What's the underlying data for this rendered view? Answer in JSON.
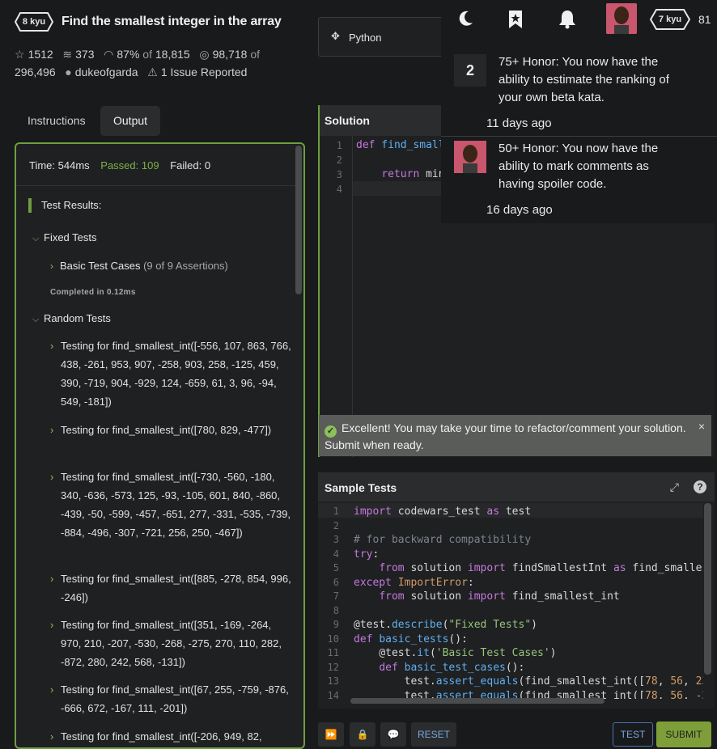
{
  "kata": {
    "rank": "8 kyu",
    "title": "Find the smallest integer in the array",
    "stars": "1512",
    "collections": "373",
    "satisfaction": "87%",
    "of_votes_prefix": "of",
    "votes": "18,815",
    "completions": "98,718",
    "of_completions_prefix": "of",
    "attempts": "296,496",
    "author": "dukeofgarda",
    "issues": "1 Issue Reported"
  },
  "tabs": [
    "Instructions",
    "Output"
  ],
  "output": {
    "time_label": "Time: 544ms",
    "passed_label": "Passed: 109",
    "failed_label": "Failed: 0",
    "results_heading": "Test Results:",
    "fixed_group": "Fixed Tests",
    "basic_group": "Basic Test Cases",
    "basic_assertions": "(9 of 9 Assertions)",
    "completed": "Completed in 0.12ms",
    "random_group": "Random Tests",
    "random_tests": [
      "Testing for find_smallest_int([-556, 107, 863, 766, 438, -261, 953, 907, -258, 903, 258, -125, 459, 390, -719, 904, -929, 124, -659, 61, 3, 96, -94, 549, -181])",
      "Testing for find_smallest_int([780, 829, -477])",
      "Testing for find_smallest_int([-730, -560, -180, 340, -636, -573, 125, -93, -105, 601, 840, -860, -439, -50, -599, -457, -651, 277, -331, -535, -739, -884, -496, -307, -721, 256, 250, -467])",
      "Testing for find_smallest_int([885, -278, 854, 996, -246])",
      "Testing for find_smallest_int([351, -169, -264, 970, 210, -207, -530, -268, -275, 270, 110, 282, -872, 280, 242, 568, -131])",
      "Testing for find_smallest_int([67, 255, -759, -876, -666, 672, -167, 111, -201])",
      "Testing for find_smallest_int([-206, 949, 82,"
    ]
  },
  "language": "Python",
  "solution": {
    "heading": "Solution",
    "line_numbers": [
      "1",
      "2",
      "3",
      "4"
    ],
    "line1_kw": "def",
    "line1_rest": " find_small",
    "line3_kw": "return",
    "line3_rest": " min"
  },
  "banner": {
    "message": "Excellent! You may take your time to refactor/comment your solution. Submit when ready.",
    "close": "×"
  },
  "sample_tests": {
    "heading": "Sample Tests",
    "help": "?",
    "line_numbers": [
      "1",
      "2",
      "3",
      "4",
      "5",
      "6",
      "7",
      "8",
      "9",
      "10",
      "11",
      "12",
      "13",
      "14"
    ]
  },
  "buttons": {
    "reset": "RESET",
    "test": "TEST",
    "submit": "SUBMIT"
  },
  "user": {
    "rank": "7 kyu",
    "honor": "81"
  },
  "notifications": [
    {
      "badge": "2",
      "text": "75+ Honor: You now have the ability to estimate the ranking of your own beta kata.",
      "date": "11 days ago"
    },
    {
      "text": "50+ Honor: You now have the ability to mark comments as having spoiler code.",
      "date": "16 days ago"
    }
  ],
  "colors": {
    "accent_green": "#6f9e3f",
    "passed_green": "#7eb04a",
    "submit_bg": "#7e9e3a",
    "link_blue": "#79a8e0"
  }
}
